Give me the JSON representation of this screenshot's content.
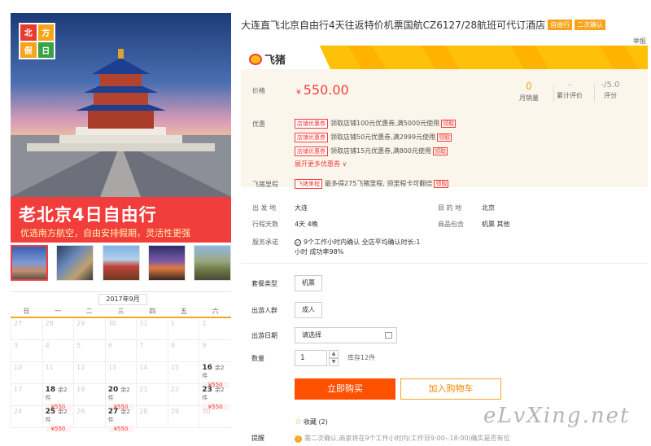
{
  "hero": {
    "logo_chars": [
      "北",
      "方",
      "假",
      "日"
    ],
    "banner_title": "老北京4日自由行",
    "banner_subtitle": "优选南方航空，自由安排假期，灵活性更强"
  },
  "calendar": {
    "month": "2017年9月",
    "weekdays": [
      "日",
      "一",
      "二",
      "三",
      "四",
      "五",
      "六"
    ],
    "weeks": [
      [
        {
          "d": "27"
        },
        {
          "d": "28"
        },
        {
          "d": "29"
        },
        {
          "d": "30"
        },
        {
          "d": "31"
        },
        {
          "d": "1"
        },
        {
          "d": "2"
        }
      ],
      [
        {
          "d": "3"
        },
        {
          "d": "4"
        },
        {
          "d": "5"
        },
        {
          "d": "6"
        },
        {
          "d": "7"
        },
        {
          "d": "8"
        },
        {
          "d": "9"
        }
      ],
      [
        {
          "d": "10"
        },
        {
          "d": "11"
        },
        {
          "d": "12"
        },
        {
          "d": "13"
        },
        {
          "d": "14"
        },
        {
          "d": "15"
        },
        {
          "d": "16",
          "rem": "余2件",
          "price": "¥550"
        }
      ],
      [
        {
          "d": "17"
        },
        {
          "d": "18",
          "rem": "余2件",
          "price": "¥550"
        },
        {
          "d": "19"
        },
        {
          "d": "20",
          "rem": "余2件",
          "price": "¥550"
        },
        {
          "d": "21"
        },
        {
          "d": "22"
        },
        {
          "d": "23",
          "rem": "余2件",
          "price": "¥550"
        }
      ],
      [
        {
          "d": "24"
        },
        {
          "d": "25",
          "rem": "余2件",
          "price": "¥550"
        },
        {
          "d": "26"
        },
        {
          "d": "27",
          "rem": "余2件",
          "price": "¥550"
        },
        {
          "d": "28"
        },
        {
          "d": "29"
        },
        {
          "d": "30"
        }
      ]
    ]
  },
  "product": {
    "title": "大连直飞北京自由行4天往返特价机票国航CZ6127/28航班可代订酒店",
    "tag1": "自由行",
    "tag2": "二次确认",
    "report": "举报",
    "brand": "飞猪"
  },
  "price_panel": {
    "price_label": "价格",
    "currency": "¥",
    "price": "550.00",
    "stats": [
      {
        "value": "0",
        "label": "月销量"
      },
      {
        "value": "-",
        "label": "累计评价"
      },
      {
        "value": "-/5.0",
        "label": "评分"
      }
    ],
    "coupon_label": "优惠",
    "coupons": [
      {
        "tag": "店铺优惠券",
        "text": "领取店铺100元优惠券,满5000元使用",
        "action": "领取"
      },
      {
        "tag": "店铺优惠券",
        "text": "领取店铺50元优惠券,满2999元使用",
        "action": "领取"
      },
      {
        "tag": "店铺优惠券",
        "text": "领取店铺15元优惠券,满800元使用",
        "action": "领取"
      }
    ],
    "more_coupons": "展开更多优惠券 ∨",
    "mileage_label": "飞猪里程",
    "mileage_tag": "飞猪里程",
    "mileage_text": "最多得275飞猪里程, 领里程卡可翻倍",
    "mileage_action": "领取"
  },
  "info": {
    "depart_label": "出 发 地",
    "depart": "大连",
    "dest_label": "目 的 地",
    "dest": "北京",
    "days_label": "行程天数",
    "days": "4天  4晚",
    "includes_label": "商品包含",
    "includes": "机票  其他",
    "service_label": "服务承诺",
    "promise_line1": "9个工作小时内确认 全店平均确认时长:1",
    "promise_line2": "小时 成功率98%"
  },
  "options": {
    "package_label": "套餐类型",
    "package_value": "机票",
    "people_label": "出游人群",
    "people_value": "成人",
    "date_label": "出游日期",
    "date_placeholder": "请选择",
    "qty_label": "数量",
    "qty_value": "1",
    "stock": "库存12件",
    "buy_label": "立即购买",
    "cart_label": "加入购物车",
    "fav_label": "收藏",
    "fav_count": "(2)",
    "remind_label": "提醒",
    "remind_text": "需二次确认,商家将在9个工作小时内(工作日9:00--18:00)确实是否有位"
  },
  "watermark": "eLvXing.net"
}
